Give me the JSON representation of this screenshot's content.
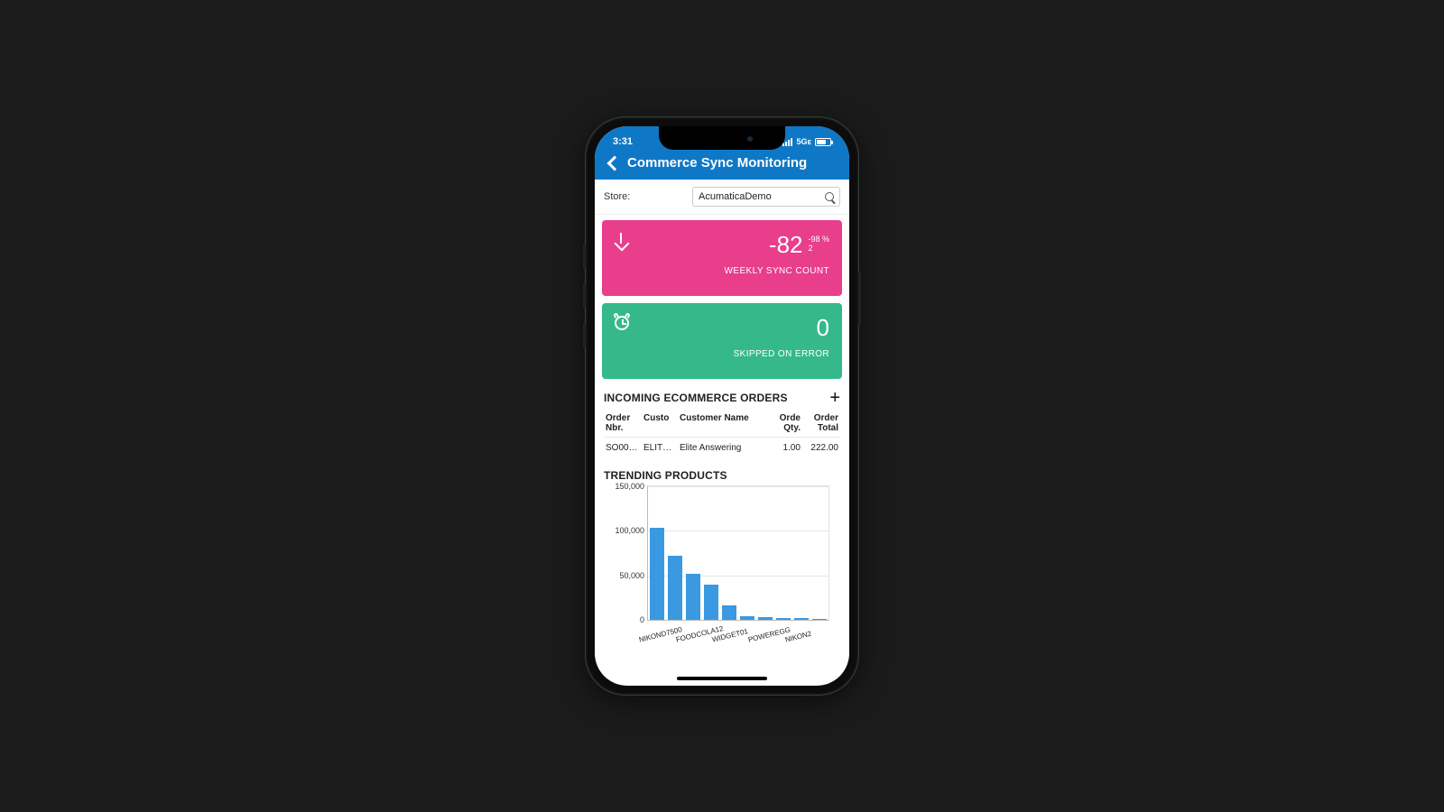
{
  "status_bar": {
    "time": "3:31",
    "network": "5Gᴇ"
  },
  "header": {
    "title": "Commerce Sync Monitoring"
  },
  "store": {
    "label": "Store:",
    "value": "AcumaticaDemo"
  },
  "cards": {
    "sync": {
      "value": "-82",
      "delta_pct": "-98 %",
      "delta_base": "2",
      "label": "WEEKLY SYNC COUNT"
    },
    "skipped": {
      "value": "0",
      "label": "SKIPPED ON ERROR"
    }
  },
  "orders": {
    "title": "INCOMING ECOMMERCE ORDERS",
    "columns": {
      "nbr": "Order Nbr.",
      "cust": "Custo",
      "name": "Customer Name",
      "qty": "Orde Qty.",
      "total": "Order Total"
    },
    "rows": [
      {
        "nbr": "SO00…",
        "cust": "ELIT…",
        "name": "Elite Answering",
        "qty": "1.00",
        "total": "222.00"
      }
    ]
  },
  "trending": {
    "title": "TRENDING PRODUCTS"
  },
  "chart_data": {
    "type": "bar",
    "title": "TRENDING PRODUCTS",
    "ylabel": "",
    "xlabel": "",
    "ylim": [
      0,
      150000
    ],
    "yticks": [
      0,
      50000,
      100000,
      150000
    ],
    "ytick_labels": [
      "0",
      "50,000",
      "100,000",
      "150,000"
    ],
    "categories": [
      "NIKOND7500",
      "",
      "FOODCOLA12",
      "",
      "WIDGET01",
      "",
      "POWEREGG",
      "",
      "NIKON2",
      ""
    ],
    "values": [
      103000,
      72000,
      52000,
      40000,
      16000,
      4000,
      3000,
      2500,
      2000,
      1500
    ]
  }
}
